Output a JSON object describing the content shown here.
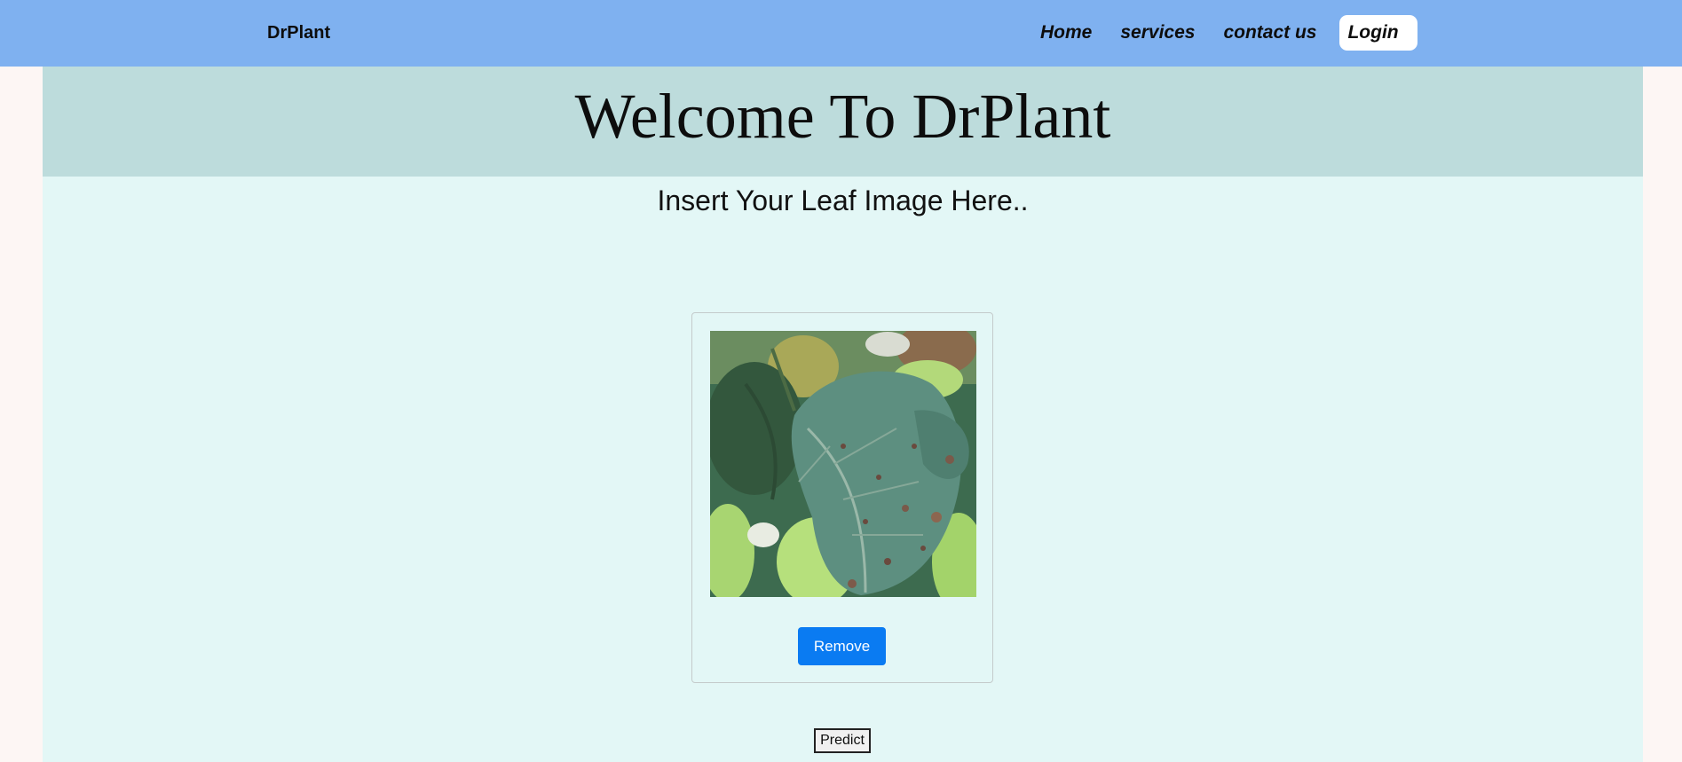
{
  "navbar": {
    "brand": "DrPlant",
    "links": [
      "Home",
      "services",
      "contact us"
    ],
    "login_label": "Login"
  },
  "hero": {
    "title": "Welcome To DrPlant"
  },
  "upload": {
    "instruction": "Insert Your Leaf Image Here..",
    "remove_label": "Remove",
    "predict_label": "Predict"
  },
  "colors": {
    "navbar_bg": "#7fb1f0",
    "hero_bg": "#bddcdc",
    "content_bg": "#e3f7f6",
    "remove_button": "#0a7bf2"
  }
}
